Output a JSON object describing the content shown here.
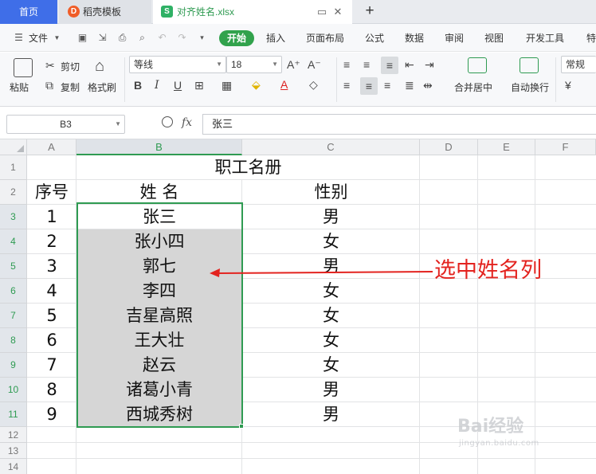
{
  "tabs": {
    "home": "首页",
    "templates": "稻壳模板",
    "templates_icon": "D",
    "file": "对齐姓名.xlsx",
    "file_icon": "S"
  },
  "menu": {
    "file": "文件",
    "items": [
      "开始",
      "插入",
      "页面布局",
      "公式",
      "数据",
      "审阅",
      "视图",
      "开发工具",
      "特"
    ]
  },
  "ribbon": {
    "paste": "粘贴",
    "cut": "剪切",
    "copy": "复制",
    "format_painter": "格式刷",
    "font_name": "等线",
    "font_size": "18",
    "bold": "B",
    "italic": "I",
    "underline": "U",
    "merge_center": "合并居中",
    "auto_wrap": "自动换行",
    "number_format": "常规",
    "currency": "¥"
  },
  "formula_bar": {
    "name_box": "B3",
    "fx_label": "fx",
    "content": "张三"
  },
  "sheet": {
    "columns": [
      "A",
      "B",
      "C",
      "D",
      "E",
      "F"
    ],
    "rows": [
      "1",
      "2",
      "3",
      "4",
      "5",
      "6",
      "7",
      "8",
      "9",
      "10",
      "11",
      "12",
      "13",
      "14"
    ],
    "title": "职工名册",
    "headers": [
      "序号",
      "姓  名",
      "性别"
    ],
    "records": [
      [
        "1",
        "张三",
        "男"
      ],
      [
        "2",
        "张小四",
        "女"
      ],
      [
        "3",
        "郭七",
        "男"
      ],
      [
        "4",
        "李四",
        "女"
      ],
      [
        "5",
        "吉星高照",
        "女"
      ],
      [
        "6",
        "王大壮",
        "女"
      ],
      [
        "7",
        "赵云",
        "女"
      ],
      [
        "8",
        "诸葛小青",
        "男"
      ],
      [
        "9",
        "西城秀树",
        "男"
      ]
    ]
  },
  "annotation": {
    "text": "选中姓名列",
    "color": "#e3231f"
  },
  "watermark": {
    "main": "Bai经验",
    "sub": "jingyan.baidu.com"
  },
  "colors": {
    "accent_green": "#2f9b52",
    "home_tab": "#3f6ee8"
  }
}
